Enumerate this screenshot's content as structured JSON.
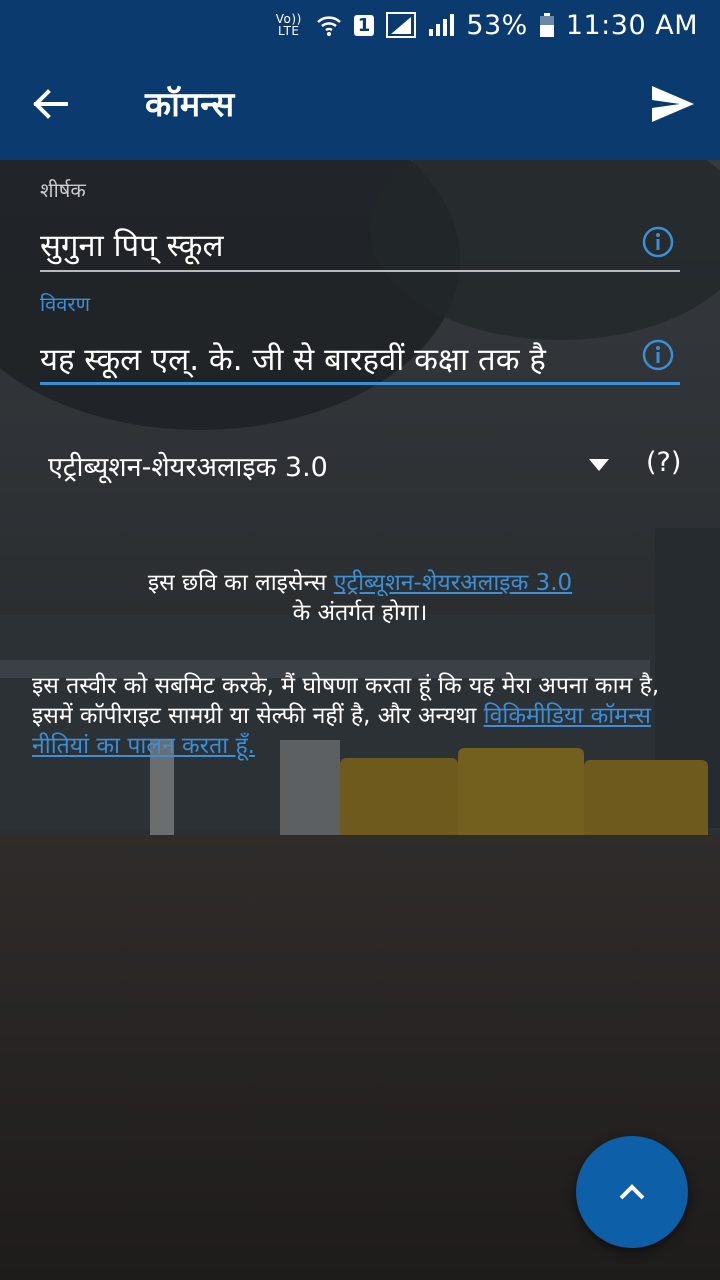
{
  "status_bar": {
    "network": "Vo)) LTE",
    "sim": "1",
    "battery": "53%",
    "time": "11:30 AM"
  },
  "app_bar": {
    "title": "कॉमन्स"
  },
  "form": {
    "title_label": "शीर्षक",
    "title_value": "सुगुना पिप् स्कूल",
    "description_label": "विवरण",
    "description_value": "यह स्कूल एल्. के. जी से बारहवीं कक्षा तक है",
    "license_value": "एट्रीब्यूशन-शेयरअलाइक 3.0",
    "license_help": "(?)"
  },
  "notice": {
    "license_prefix": "इस छवि का लाइसेन्स ",
    "license_link": "एट्रीब्यूशन-शेयरअलाइक 3.0",
    "license_suffix": "के अंतर्गत होगा।",
    "declaration": "इस तस्वीर को सबमिट करके, मैं घोषणा करता हूं कि यह मेरा अपना काम है, इसमें कॉपीराइट सामग्री या सेल्फी नहीं है, और अन्यथा ",
    "policy_link": "विकिमीडिया कॉमन्स नीतियां का पालन करता हूँ."
  },
  "colors": {
    "app_bar": "#0b3a6e",
    "accent": "#3a8fd6",
    "fab": "#0d5fa8"
  }
}
